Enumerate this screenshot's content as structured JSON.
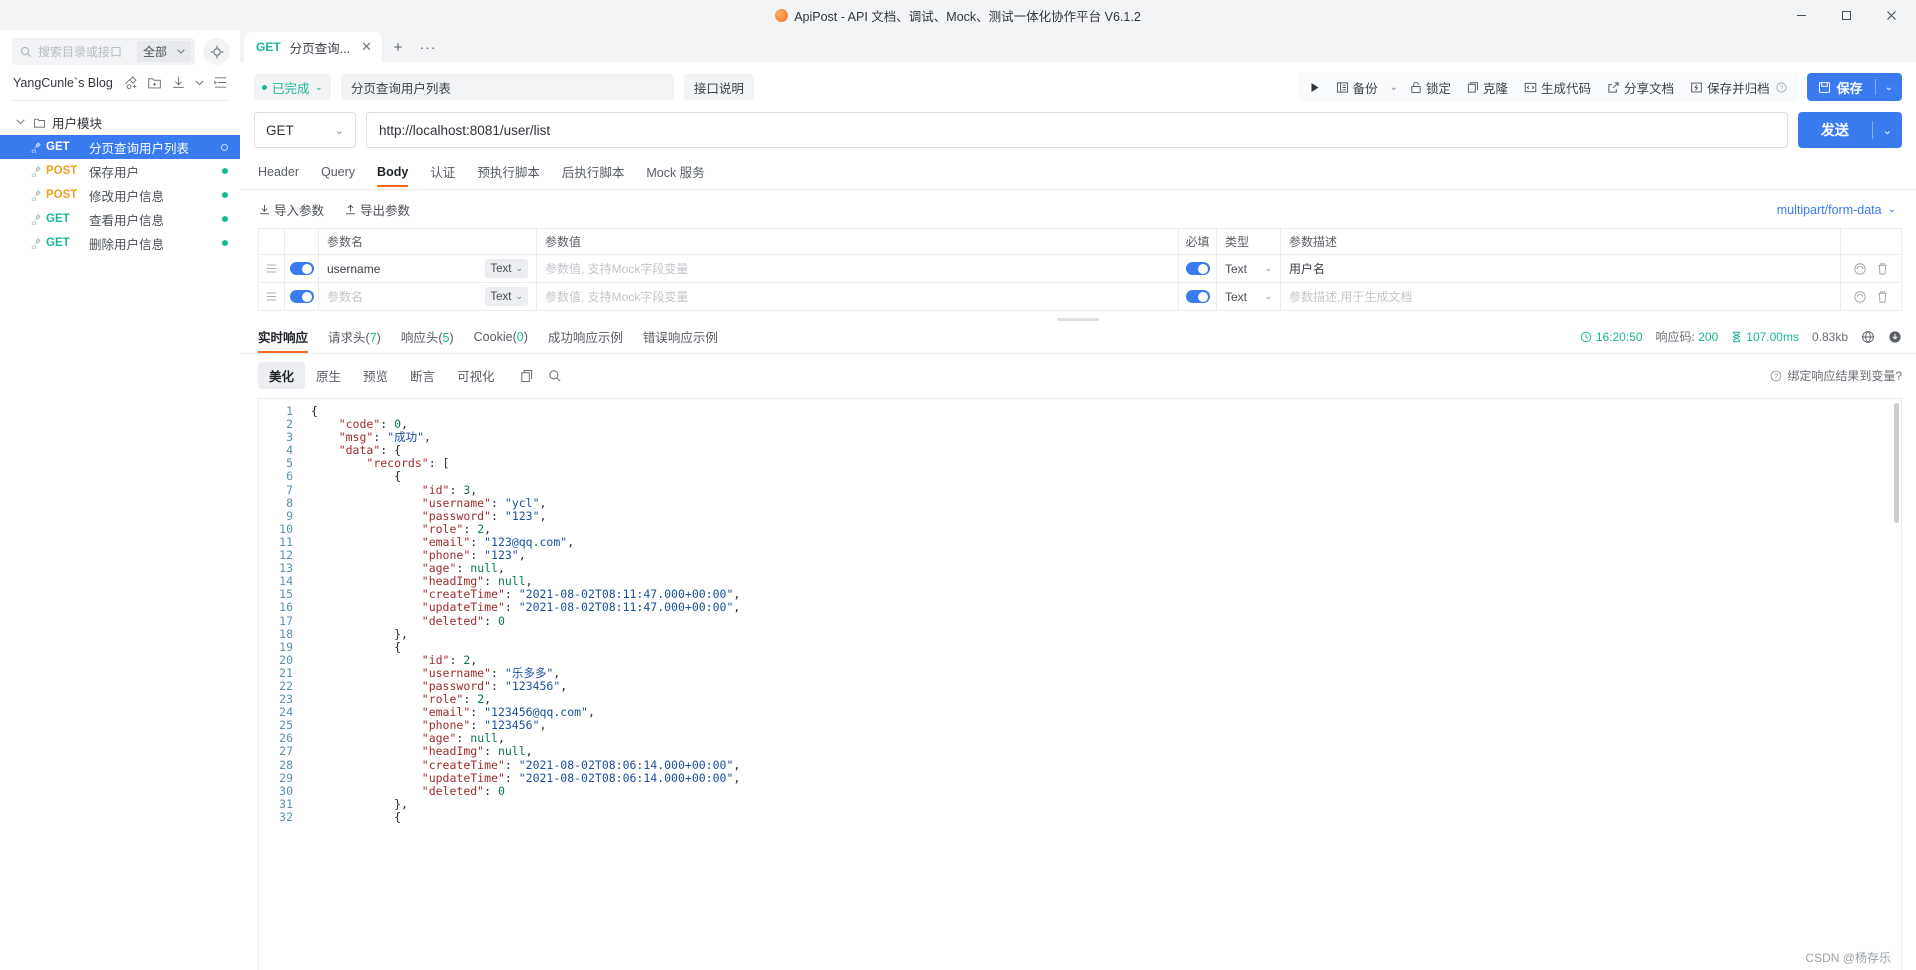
{
  "window": {
    "title": "ApiPost - API 文档、调试、Mock、测试一体化协作平台 V6.1.2",
    "minimize": "−",
    "maximize": "▢",
    "close": "✕"
  },
  "sidebar": {
    "search_placeholder": "搜索目录或接口",
    "scope_label": "全部",
    "project_name": "YangCunle`s Blog",
    "folder": {
      "label": "用户模块"
    },
    "items": [
      {
        "method": "GET",
        "name": "分页查询用户列表",
        "active": true
      },
      {
        "method": "POST",
        "name": "保存用户",
        "active": false
      },
      {
        "method": "POST",
        "name": "修改用户信息",
        "active": false
      },
      {
        "method": "GET",
        "name": "查看用户信息",
        "active": false
      },
      {
        "method": "GET",
        "name": "删除用户信息",
        "active": false
      }
    ]
  },
  "tabbar": {
    "tab_method": "GET",
    "tab_title": "分页查询...",
    "close": "✕",
    "add": "+",
    "more": "···"
  },
  "request": {
    "status_label": "已完成",
    "name_value": "分页查询用户列表",
    "desc_button": "接口说明",
    "method": "GET",
    "url": "http://localhost:8081/user/list",
    "send_label": "发送"
  },
  "toolbar": {
    "run_icon": "▶",
    "backup": "备份",
    "lock": "锁定",
    "clone": "克隆",
    "gen_code": "生成代码",
    "share_doc": "分享文档",
    "save_archive": "保存并归档",
    "help": "?",
    "save": "保存"
  },
  "request_tabs": [
    {
      "label": "Header",
      "active": false
    },
    {
      "label": "Query",
      "active": false
    },
    {
      "label": "Body",
      "active": true
    },
    {
      "label": "认证",
      "active": false
    },
    {
      "label": "预执行脚本",
      "active": false
    },
    {
      "label": "后执行脚本",
      "active": false
    },
    {
      "label": "Mock 服务",
      "active": false
    }
  ],
  "param_actions": {
    "import": "导入参数",
    "export": "导出参数",
    "body_type": "multipart/form-data"
  },
  "params_table": {
    "headers": [
      "参数名",
      "参数值",
      "必填",
      "类型",
      "参数描述"
    ],
    "rows": [
      {
        "enabled": true,
        "name": "username",
        "name_placeholder": "参数名",
        "value_type": "Text",
        "value": "",
        "value_placeholder": "参数值, 支持Mock字段变量",
        "required": true,
        "type": "Text",
        "desc": "用户名",
        "desc_placeholder": "参数描述,用于生成文档"
      },
      {
        "enabled": true,
        "name": "",
        "name_placeholder": "参数名",
        "value_type": "Text",
        "value": "",
        "value_placeholder": "参数值, 支持Mock字段变量",
        "required": true,
        "type": "Text",
        "desc": "",
        "desc_placeholder": "参数描述,用于生成文档"
      }
    ]
  },
  "response_tabs": [
    {
      "label": "实时响应",
      "count": "",
      "active": true
    },
    {
      "label": "请求头",
      "count": "7",
      "active": false
    },
    {
      "label": "响应头",
      "count": "5",
      "active": false
    },
    {
      "label": "Cookie",
      "count": "0",
      "active": false
    },
    {
      "label": "成功响应示例",
      "count": "",
      "active": false
    },
    {
      "label": "错误响应示例",
      "count": "",
      "active": false
    }
  ],
  "response_meta": {
    "time": "16:20:50",
    "status_label": "响应码:",
    "status_code": "200",
    "duration": "107.00ms",
    "size": "0.83kb"
  },
  "format_tabs": [
    {
      "label": "美化",
      "active": true
    },
    {
      "label": "原生",
      "active": false
    },
    {
      "label": "预览",
      "active": false
    },
    {
      "label": "断言",
      "active": false
    },
    {
      "label": "可视化",
      "active": false
    }
  ],
  "format_hint": "绑定响应结果到变量?",
  "response_body": {
    "code": 0,
    "msg": "成功",
    "records": [
      {
        "id": 3,
        "username": "ycl",
        "password": "123",
        "role": 2,
        "email": "123@qq.com",
        "phone": "123",
        "age": null,
        "headImg": null,
        "createTime": "2021-08-02T08:11:47.000+00:00",
        "updateTime": "2021-08-02T08:11:47.000+00:00",
        "deleted": 0
      },
      {
        "id": 2,
        "username": "乐多多",
        "password": "123456",
        "role": 2,
        "email": "123456@qq.com",
        "phone": "123456",
        "age": null,
        "headImg": null,
        "createTime": "2021-08-02T08:06:14.000+00:00",
        "updateTime": "2021-08-02T08:06:14.000+00:00",
        "deleted": 0
      }
    ],
    "last_line_number": 32
  },
  "watermark": "CSDN @杨存乐",
  "colors": {
    "accent": "#3a7bf0",
    "get": "#19b798",
    "post": "#f0a020",
    "active_underline": "#f56a1e"
  }
}
